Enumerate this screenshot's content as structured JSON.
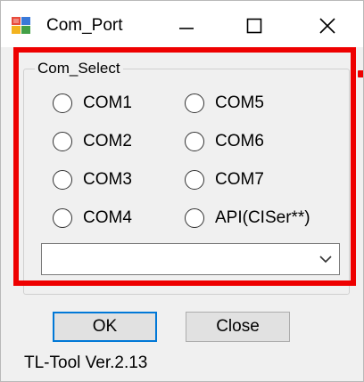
{
  "window": {
    "title": "Com_Port",
    "icon": "app-icon",
    "controls": {
      "minimize_icon": "minimize-icon",
      "maximize_icon": "maximize-icon",
      "close_icon": "close-icon"
    }
  },
  "group": {
    "label": "Com_Select",
    "radios_left": [
      {
        "label": "COM1",
        "checked": false
      },
      {
        "label": "COM2",
        "checked": false
      },
      {
        "label": "COM3",
        "checked": false
      },
      {
        "label": "COM4",
        "checked": false
      }
    ],
    "radios_right": [
      {
        "label": "COM5",
        "checked": false
      },
      {
        "label": "COM6",
        "checked": false
      },
      {
        "label": "COM7",
        "checked": false
      },
      {
        "label": "API(CISer**)",
        "checked": false
      }
    ],
    "combo_value": ""
  },
  "buttons": {
    "ok_label": "OK",
    "close_label": "Close"
  },
  "footer": {
    "version": "TL-Tool Ver.2.13"
  },
  "colors": {
    "highlight": "#ee0000",
    "focus_border": "#0078d7",
    "dialog_bg": "#f0f0f0"
  }
}
